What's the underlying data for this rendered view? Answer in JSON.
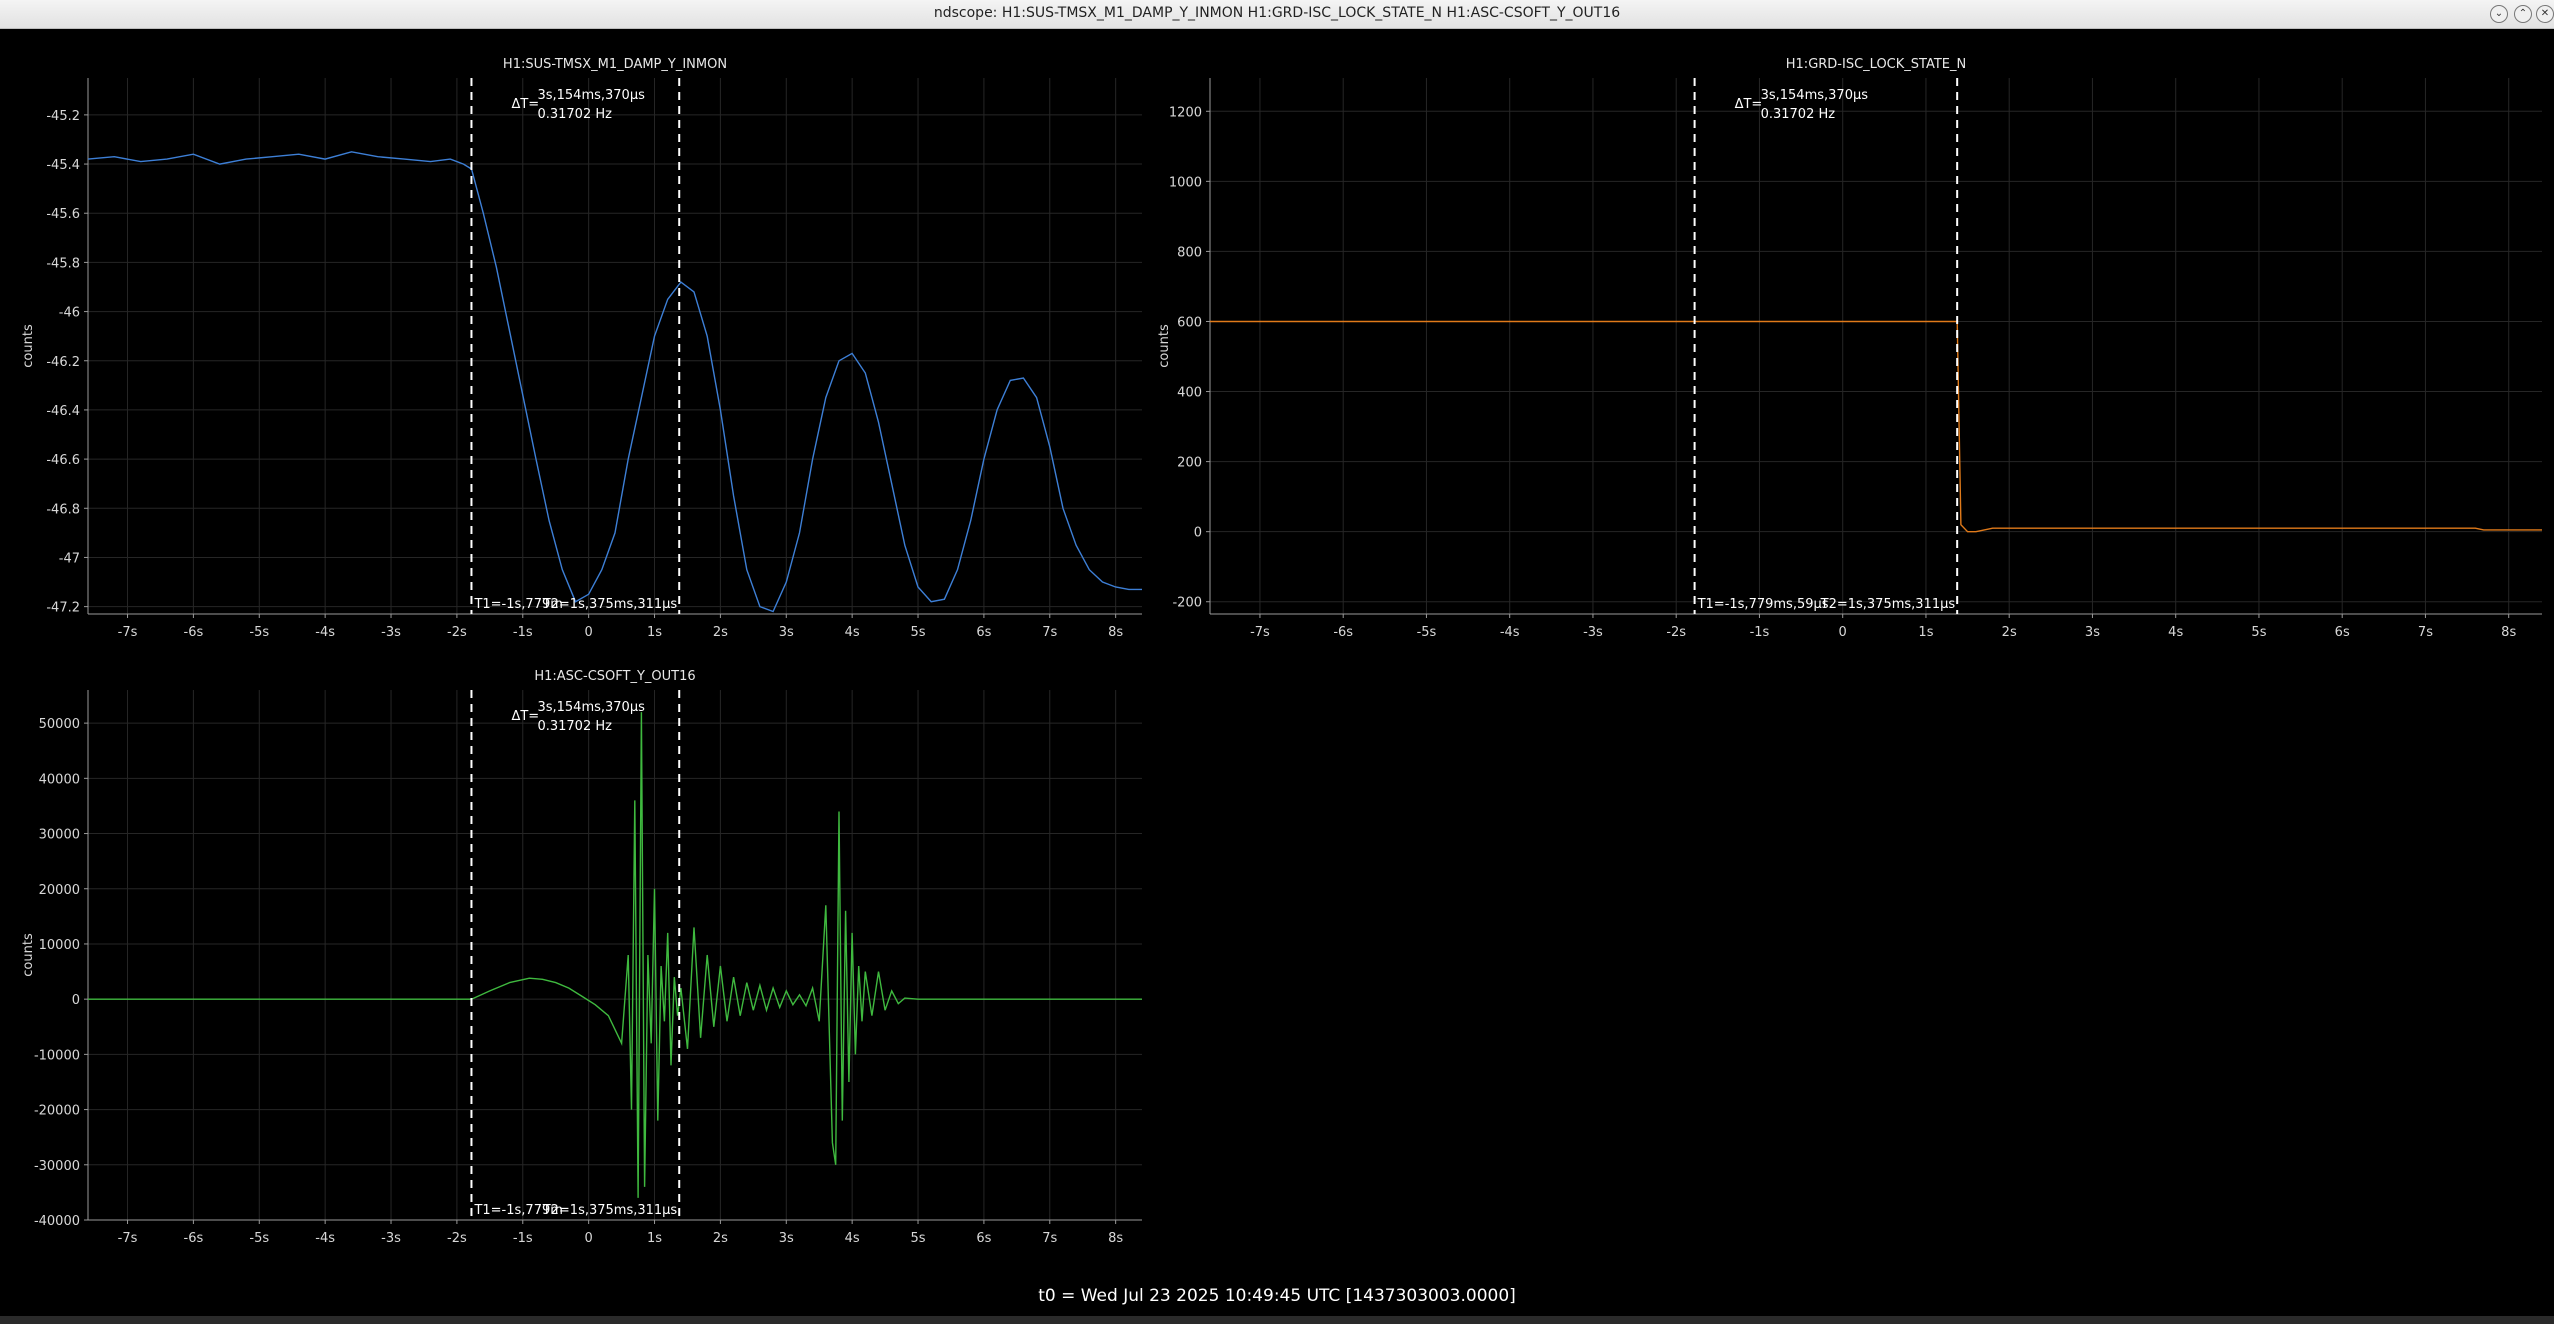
{
  "window": {
    "title": "ndscope: H1:SUS-TMSX_M1_DAMP_Y_INMON H1:GRD-ISC_LOCK_STATE_N H1:ASC-CSOFT_Y_OUT16",
    "minimize_icon": "chevron-down-icon",
    "close_icon": "close-icon"
  },
  "footer": {
    "t0_text": "t0 = Wed Jul 23 2025 10:49:45 UTC [1437303003.0000]"
  },
  "chart_data": [
    {
      "id": "p1",
      "type": "line",
      "title": "H1:SUS-TMSX_M1_DAMP_Y_INMON",
      "ylabel": "counts",
      "xlabel": "",
      "x_ticks": [
        "-7s",
        "-6s",
        "-5s",
        "-4s",
        "-3s",
        "-2s",
        "-1s",
        "0",
        "1s",
        "2s",
        "3s",
        "4s",
        "5s",
        "6s",
        "7s",
        "8s"
      ],
      "x_tick_values": [
        -7,
        -6,
        -5,
        -4,
        -3,
        -2,
        -1,
        0,
        1,
        2,
        3,
        4,
        5,
        6,
        7,
        8
      ],
      "y_ticks": [
        "-45.2",
        "-45.4",
        "-45.6",
        "-45.8",
        "-46",
        "-46.2",
        "-46.4",
        "-46.6",
        "-46.8",
        "-47",
        "-47.2"
      ],
      "y_tick_values": [
        -45.2,
        -45.4,
        -45.6,
        -45.8,
        -46,
        -46.2,
        -46.4,
        -46.6,
        -46.8,
        -47,
        -47.2
      ],
      "xlim": [
        -7.6,
        8.4
      ],
      "ylim": [
        -47.23,
        -45.05
      ],
      "grid": true,
      "color": "#3d7fd6",
      "series": [
        {
          "x": [
            -7.6,
            -7.2,
            -6.8,
            -6.4,
            -6.0,
            -5.6,
            -5.2,
            -4.8,
            -4.4,
            -4.0,
            -3.6,
            -3.2,
            -2.8,
            -2.4,
            -2.1,
            -1.9,
            -1.779,
            -1.6,
            -1.4,
            -1.2,
            -1.0,
            -0.8,
            -0.6,
            -0.4,
            -0.2,
            0.0,
            0.2,
            0.4,
            0.6,
            0.8,
            1.0,
            1.2,
            1.4,
            1.6,
            1.8,
            2.0,
            2.2,
            2.4,
            2.6,
            2.8,
            3.0,
            3.2,
            3.4,
            3.6,
            3.8,
            4.0,
            4.2,
            4.4,
            4.6,
            4.8,
            5.0,
            5.2,
            5.4,
            5.6,
            5.8,
            6.0,
            6.2,
            6.4,
            6.6,
            6.8,
            7.0,
            7.2,
            7.4,
            7.6,
            7.8,
            8.0,
            8.2,
            8.4
          ],
          "y": [
            -45.38,
            -45.37,
            -45.39,
            -45.38,
            -45.36,
            -45.4,
            -45.38,
            -45.37,
            -45.36,
            -45.38,
            -45.35,
            -45.37,
            -45.38,
            -45.39,
            -45.38,
            -45.4,
            -45.42,
            -45.6,
            -45.82,
            -46.08,
            -46.34,
            -46.6,
            -46.85,
            -47.05,
            -47.18,
            -47.15,
            -47.05,
            -46.9,
            -46.6,
            -46.35,
            -46.1,
            -45.95,
            -45.88,
            -45.92,
            -46.1,
            -46.4,
            -46.75,
            -47.05,
            -47.2,
            -47.22,
            -47.1,
            -46.9,
            -46.6,
            -46.35,
            -46.2,
            -46.17,
            -46.25,
            -46.45,
            -46.7,
            -46.95,
            -47.12,
            -47.18,
            -47.17,
            -47.05,
            -46.85,
            -46.6,
            -46.4,
            -46.28,
            -46.27,
            -46.35,
            -46.55,
            -46.8,
            -46.95,
            -47.05,
            -47.1,
            -47.12,
            -47.13,
            -47.13
          ]
        }
      ],
      "cursors": {
        "t1": -1.779,
        "t2": 1.375,
        "t1_label": "T1=-1s,779m",
        "t2_label": "T2=1s,375ms,311µs"
      },
      "delta": {
        "label": "ΔT=",
        "time": "3s,154ms,370µs",
        "freq": "0.31702 Hz"
      }
    },
    {
      "id": "p2",
      "type": "line",
      "title": "H1:GRD-ISC_LOCK_STATE_N",
      "ylabel": "counts",
      "xlabel": "",
      "x_ticks": [
        "-7s",
        "-6s",
        "-5s",
        "-4s",
        "-3s",
        "-2s",
        "-1s",
        "0",
        "1s",
        "2s",
        "3s",
        "4s",
        "5s",
        "6s",
        "7s",
        "8s"
      ],
      "x_tick_values": [
        -7,
        -6,
        -5,
        -4,
        -3,
        -2,
        -1,
        0,
        1,
        2,
        3,
        4,
        5,
        6,
        7,
        8
      ],
      "y_ticks": [
        "1200",
        "1000",
        "800",
        "600",
        "400",
        "200",
        "0",
        "-200"
      ],
      "y_tick_values": [
        1200,
        1000,
        800,
        600,
        400,
        200,
        0,
        -200
      ],
      "xlim": [
        -7.6,
        8.4
      ],
      "ylim": [
        -235,
        1295
      ],
      "grid": true,
      "color": "#e07a1a",
      "series": [
        {
          "x": [
            -7.6,
            -2.0,
            1.0,
            1.375,
            1.42,
            1.5,
            1.6,
            1.8,
            2.0,
            4.0,
            6.0,
            7.6,
            7.7,
            8.4
          ],
          "y": [
            600,
            600,
            600,
            600,
            20,
            0,
            0,
            10,
            10,
            10,
            10,
            10,
            5,
            5
          ]
        }
      ],
      "cursors": {
        "t1": -1.779,
        "t2": 1.375,
        "t1_label": "T1=-1s,779ms,59µs",
        "t2_label": "T2=1s,375ms,311µs"
      },
      "delta": {
        "label": "ΔT=",
        "time": "3s,154ms,370µs",
        "freq": "0.31702 Hz"
      }
    },
    {
      "id": "p3",
      "type": "line",
      "title": "H1:ASC-CSOFT_Y_OUT16",
      "ylabel": "counts",
      "xlabel": "",
      "x_ticks": [
        "-7s",
        "-6s",
        "-5s",
        "-4s",
        "-3s",
        "-2s",
        "-1s",
        "0",
        "1s",
        "2s",
        "3s",
        "4s",
        "5s",
        "6s",
        "7s",
        "8s"
      ],
      "x_tick_values": [
        -7,
        -6,
        -5,
        -4,
        -3,
        -2,
        -1,
        0,
        1,
        2,
        3,
        4,
        5,
        6,
        7,
        8
      ],
      "y_ticks": [
        "50000",
        "40000",
        "30000",
        "20000",
        "10000",
        "0",
        "-10000",
        "-20000",
        "-30000",
        "-40000"
      ],
      "y_tick_values": [
        50000,
        40000,
        30000,
        20000,
        10000,
        0,
        -10000,
        -20000,
        -30000,
        -40000
      ],
      "xlim": [
        -7.6,
        8.4
      ],
      "ylim": [
        -40000,
        56000
      ],
      "grid": true,
      "color": "#3fb93f",
      "series": [
        {
          "x": [
            -7.6,
            -6,
            -4,
            -2.0,
            -1.779,
            -1.5,
            -1.2,
            -0.9,
            -0.7,
            -0.5,
            -0.3,
            -0.1,
            0.1,
            0.3,
            0.5,
            0.6,
            0.65,
            0.7,
            0.75,
            0.8,
            0.85,
            0.9,
            0.95,
            1.0,
            1.05,
            1.1,
            1.15,
            1.2,
            1.25,
            1.3,
            1.35,
            1.4,
            1.5,
            1.6,
            1.7,
            1.8,
            1.9,
            2.0,
            2.1,
            2.2,
            2.3,
            2.4,
            2.5,
            2.6,
            2.7,
            2.8,
            2.9,
            3.0,
            3.1,
            3.2,
            3.3,
            3.4,
            3.5,
            3.6,
            3.7,
            3.75,
            3.8,
            3.85,
            3.9,
            3.95,
            4.0,
            4.05,
            4.1,
            4.15,
            4.2,
            4.3,
            4.4,
            4.5,
            4.6,
            4.7,
            4.8,
            5.0,
            6.0,
            7.0,
            8.4
          ],
          "y": [
            0,
            0,
            0,
            0,
            0,
            1500,
            3000,
            3800,
            3600,
            3000,
            2000,
            500,
            -1000,
            -3000,
            -8000,
            8000,
            -20000,
            36000,
            -36000,
            52000,
            -34000,
            8000,
            -8000,
            20000,
            -22000,
            6000,
            -4000,
            12000,
            -12000,
            4000,
            -3000,
            2000,
            -9000,
            13000,
            -7000,
            8000,
            -5000,
            6000,
            -4000,
            4000,
            -3000,
            3000,
            -2000,
            2500,
            -2000,
            2000,
            -1500,
            1500,
            -1000,
            800,
            -1200,
            2000,
            -4000,
            17000,
            -26000,
            -30000,
            34000,
            -22000,
            16000,
            -15000,
            12000,
            -10000,
            6000,
            -4000,
            5000,
            -3000,
            5000,
            -2000,
            1500,
            -800,
            200,
            0,
            0,
            0,
            0
          ]
        }
      ],
      "cursors": {
        "t1": -1.779,
        "t2": 1.375,
        "t1_label": "T1=-1s,779m",
        "t2_label": "T2=1s,375ms,311µs"
      },
      "delta": {
        "label": "ΔT=",
        "time": "3s,154ms,370µs",
        "freq": "0.31702 Hz"
      }
    }
  ]
}
